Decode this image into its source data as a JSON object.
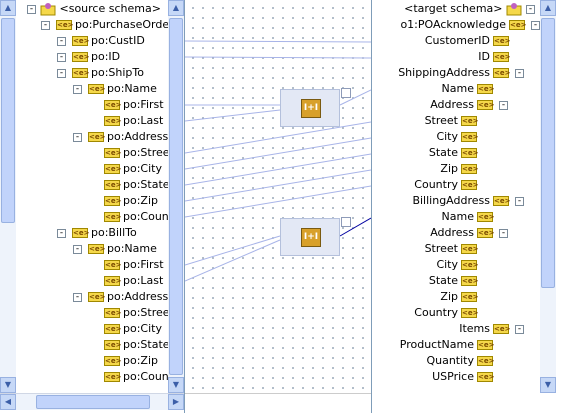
{
  "source": {
    "root_label": "<source schema>",
    "nodes": [
      {
        "label": "po:PurchaseOrder"
      },
      {
        "label": "po:CustID"
      },
      {
        "label": "po:ID"
      },
      {
        "label": "po:ShipTo"
      },
      {
        "label": "po:Name"
      },
      {
        "label": "po:First"
      },
      {
        "label": "po:Last"
      },
      {
        "label": "po:Address"
      },
      {
        "label": "po:Street"
      },
      {
        "label": "po:City"
      },
      {
        "label": "po:State"
      },
      {
        "label": "po:Zip"
      },
      {
        "label": "po:Country"
      },
      {
        "label": "po:BillTo"
      },
      {
        "label": "po:Name"
      },
      {
        "label": "po:First"
      },
      {
        "label": "po:Last"
      },
      {
        "label": "po:Address"
      },
      {
        "label": "po:Street"
      },
      {
        "label": "po:City"
      },
      {
        "label": "po:State"
      },
      {
        "label": "po:Zip"
      },
      {
        "label": "po:Country"
      }
    ]
  },
  "target": {
    "root_label": "<target schema>",
    "nodes": [
      {
        "label": "o1:POAcknowledge"
      },
      {
        "label": "CustomerID"
      },
      {
        "label": "ID"
      },
      {
        "label": "ShippingAddress"
      },
      {
        "label": "Name"
      },
      {
        "label": "Address"
      },
      {
        "label": "Street"
      },
      {
        "label": "City"
      },
      {
        "label": "State"
      },
      {
        "label": "Zip"
      },
      {
        "label": "Country"
      },
      {
        "label": "BillingAddress"
      },
      {
        "label": "Name"
      },
      {
        "label": "Address"
      },
      {
        "label": "Street"
      },
      {
        "label": "City"
      },
      {
        "label": "State"
      },
      {
        "label": "Zip"
      },
      {
        "label": "Country"
      },
      {
        "label": "Items"
      },
      {
        "label": "ProductName"
      },
      {
        "label": "Quantity"
      },
      {
        "label": "USPrice"
      }
    ]
  },
  "functions": [
    {
      "name": "concat-function-ship",
      "icon": "I+I"
    },
    {
      "name": "concat-function-bill",
      "icon": "I+I"
    }
  ],
  "icons": {
    "element": "<e>",
    "expand": "-",
    "collapse": "-"
  },
  "colors": {
    "link": "#a8b4e8",
    "selected_link": "#0000a0",
    "scroll": "#c1d3fb"
  }
}
